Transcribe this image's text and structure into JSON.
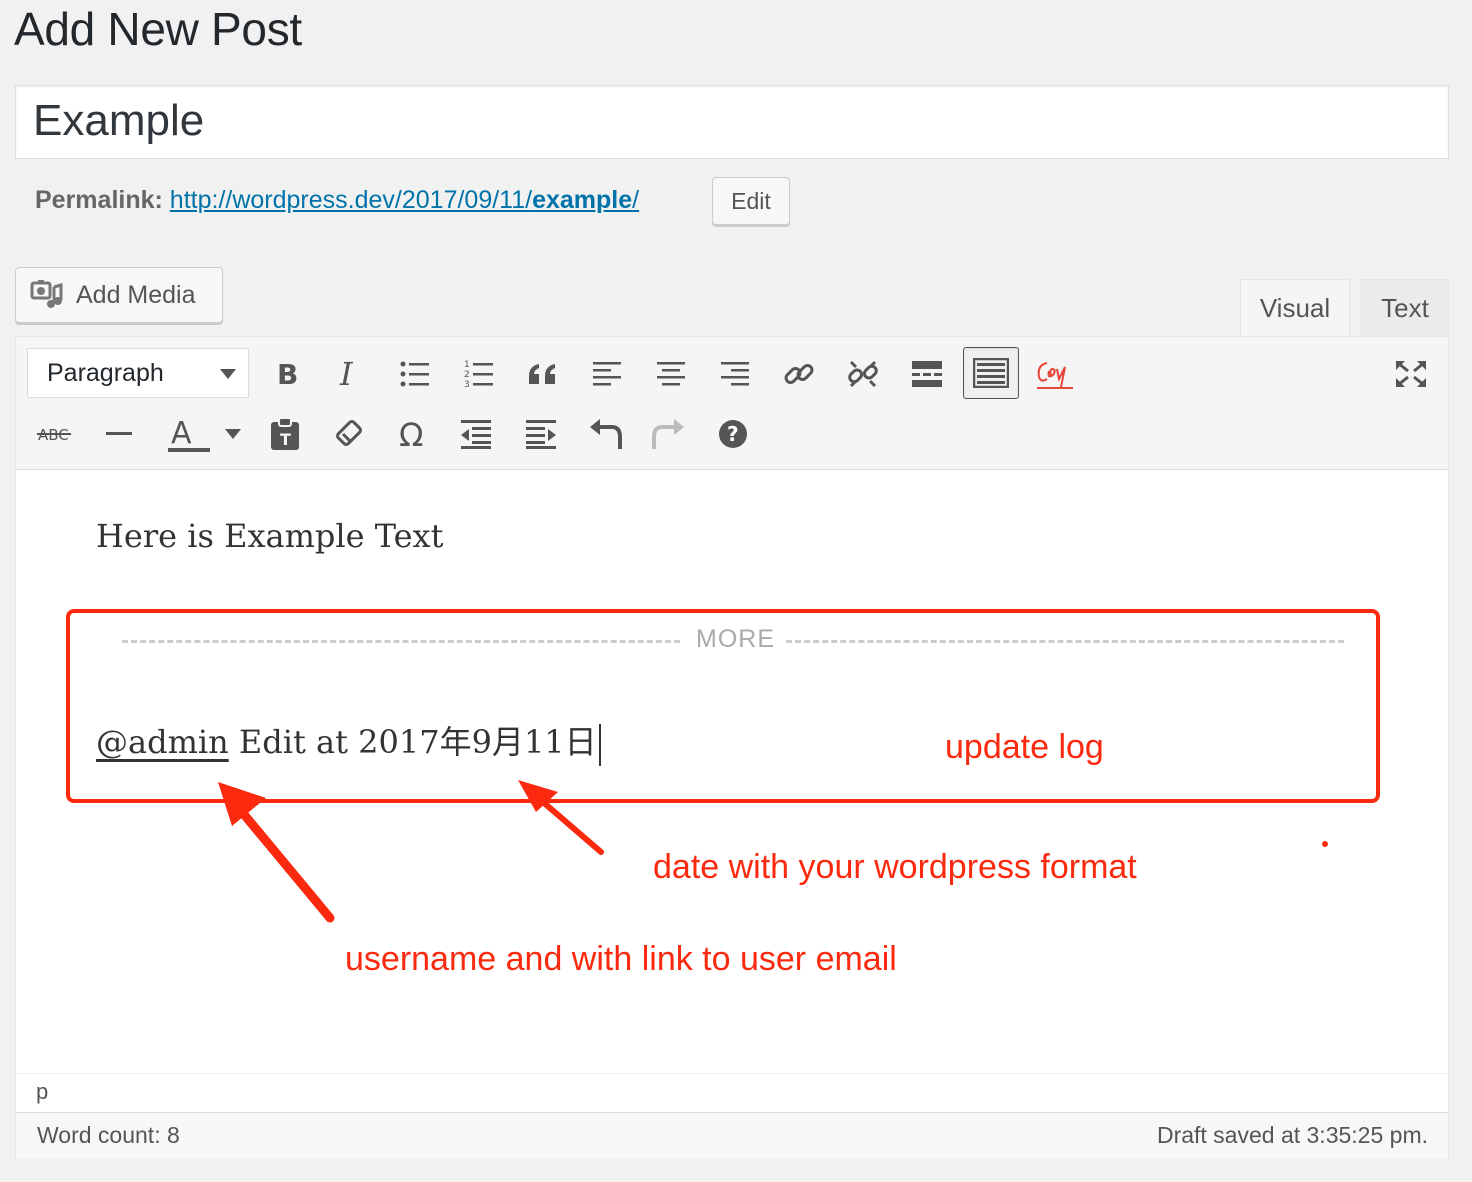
{
  "page": {
    "title": "Add New Post"
  },
  "post": {
    "title": "Example"
  },
  "permalink": {
    "label": "Permalink:",
    "url_prefix": "http://wordpress.dev/2017/09/11/",
    "url_slug": "example",
    "url_suffix": "/",
    "edit_label": "Edit"
  },
  "media": {
    "add_label": "Add Media"
  },
  "tabs": {
    "visual": "Visual",
    "text": "Text"
  },
  "toolbar": {
    "format_select": "Paragraph",
    "row1": [
      "bold",
      "italic",
      "bulleted-list",
      "numbered-list",
      "blockquote",
      "align-left",
      "align-center",
      "align-right",
      "insert-link",
      "remove-link",
      "insert-read-more",
      "toolbar-toggle",
      "copy-plugin",
      "fullscreen"
    ],
    "row2": [
      "strikethrough",
      "horizontal-line",
      "text-color",
      "paste-as-text",
      "clear-formatting",
      "special-character",
      "decrease-indent",
      "increase-indent",
      "undo",
      "redo",
      "keyboard-shortcuts"
    ],
    "strikethrough_glyph": "ABC",
    "text_color_glyph": "A",
    "special_char_glyph": "Ω",
    "help_glyph": "?"
  },
  "content": {
    "line1": "Here is Example Text",
    "more_label": "MORE",
    "username": "@admin",
    "edit_text": " Edit at 2017年9月11日"
  },
  "status": {
    "path": "p",
    "word_count": "Word count: 8",
    "draft_saved": "Draft saved at 3:35:25 pm."
  },
  "annotations": {
    "color": "#fb2a0f",
    "update_log": "update log",
    "date_note": "date with  your wordpress format",
    "username_note": "username and with link to user email"
  }
}
